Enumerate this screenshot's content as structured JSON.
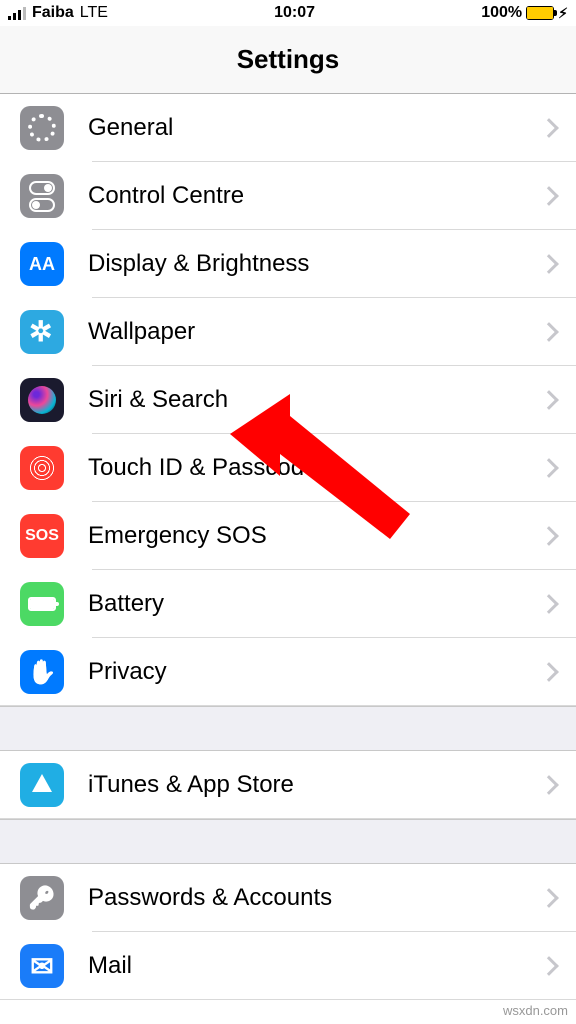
{
  "status": {
    "carrier": "Faiba",
    "network": "LTE",
    "time": "10:07",
    "battery_pct": "100%"
  },
  "header": {
    "title": "Settings"
  },
  "groups": [
    {
      "rows": [
        {
          "id": "general",
          "label": "General",
          "icon": "general-icon"
        },
        {
          "id": "control",
          "label": "Control Centre",
          "icon": "control-centre-icon"
        },
        {
          "id": "display",
          "label": "Display & Brightness",
          "icon": "display-icon"
        },
        {
          "id": "wallpaper",
          "label": "Wallpaper",
          "icon": "wallpaper-icon"
        },
        {
          "id": "siri",
          "label": "Siri & Search",
          "icon": "siri-icon"
        },
        {
          "id": "touchid",
          "label": "Touch ID & Passcode",
          "icon": "touchid-icon"
        },
        {
          "id": "sos",
          "label": "Emergency SOS",
          "icon": "sos-icon"
        },
        {
          "id": "battery",
          "label": "Battery",
          "icon": "battery-icon"
        },
        {
          "id": "privacy",
          "label": "Privacy",
          "icon": "privacy-icon"
        }
      ]
    },
    {
      "rows": [
        {
          "id": "itunes",
          "label": "iTunes & App Store",
          "icon": "appstore-icon"
        }
      ]
    },
    {
      "rows": [
        {
          "id": "passwords",
          "label": "Passwords & Accounts",
          "icon": "passwords-icon"
        },
        {
          "id": "mail",
          "label": "Mail",
          "icon": "mail-icon"
        }
      ]
    }
  ],
  "sos_text": "SOS",
  "display_text": "AA",
  "watermark": "wsxdn.com"
}
